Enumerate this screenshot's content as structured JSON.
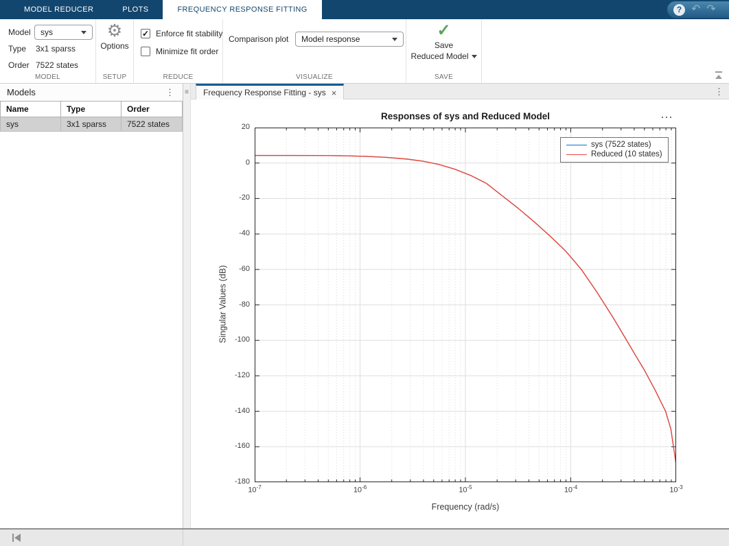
{
  "glyphs": {
    "check": "✓",
    "gear": "⚙",
    "help": "?",
    "undo": "↶",
    "redo": "↷",
    "menu_v": "⋮",
    "grip": "≡",
    "close": "×",
    "ellipsis_h": "⋯"
  },
  "header": {
    "tabs": [
      {
        "label": "MODEL REDUCER"
      },
      {
        "label": "PLOTS"
      },
      {
        "label": "FREQUENCY RESPONSE FITTING"
      }
    ]
  },
  "ribbon": {
    "model_section": {
      "title": "MODEL",
      "model_label": "Model",
      "model_value": "sys",
      "type_label": "Type",
      "type_value": "3x1 sparss",
      "order_label": "Order",
      "order_value": "7522 states"
    },
    "setup_section": {
      "title": "SETUP",
      "options_label": "Options"
    },
    "reduce_section": {
      "title": "REDUCE",
      "checkbox1": {
        "label": "Enforce fit stability",
        "checked": true
      },
      "checkbox2": {
        "label": "Minimize fit order",
        "checked": false
      }
    },
    "visualize_section": {
      "title": "VISUALIZE",
      "comparison_label": "Comparison plot",
      "comparison_value": "Model response"
    },
    "save_section": {
      "title": "SAVE",
      "line1": "Save",
      "line2": "Reduced Model"
    }
  },
  "models_panel": {
    "title": "Models",
    "columns": [
      "Name",
      "Type",
      "Order"
    ],
    "rows": [
      {
        "name": "sys",
        "type": "3x1 sparss",
        "order": "7522 states"
      }
    ]
  },
  "document": {
    "tab_label": "Frequency Response Fitting - sys"
  },
  "chart_data": {
    "type": "line",
    "title": "Responses of sys and Reduced Model",
    "xlabel": "Frequency (rad/s)",
    "ylabel": "Singular Values (dB)",
    "x_scale": "log",
    "xlim_log10": [
      -7,
      -3
    ],
    "ylim": [
      -180,
      20
    ],
    "ytick_step": 20,
    "xtick_labels": [
      "10^-7",
      "10^-6",
      "10^-5",
      "10^-4",
      "10^-3"
    ],
    "grid": true,
    "legend_position": "northeast",
    "colors": {
      "frame": "#262626",
      "grid_major": "#dedede",
      "grid_minor": "#eaeaea",
      "tick": "#262626"
    },
    "series": [
      {
        "name": "sys (7522 states)",
        "color": "#0072BD",
        "width": 1.2,
        "x_log10": [
          -7.0,
          -6.7,
          -6.4,
          -6.15,
          -5.95,
          -5.75,
          -5.55,
          -5.4,
          -5.25,
          -5.1,
          -4.95,
          -4.8,
          -4.65,
          -4.5,
          -4.35,
          -4.2,
          -4.05,
          -3.9,
          -3.75,
          -3.6,
          -3.5,
          -3.4,
          -3.3,
          -3.2,
          -3.1,
          -3.05,
          -3.0
        ],
        "y_db": [
          4.3,
          4.3,
          4.25,
          4.1,
          3.8,
          3.2,
          2.2,
          1.0,
          -0.8,
          -3.5,
          -7.0,
          -11.5,
          -18.5,
          -25.5,
          -33.0,
          -41.0,
          -49.5,
          -60.0,
          -73.0,
          -87.0,
          -97.0,
          -107.0,
          -117.0,
          -128.0,
          -140.0,
          -150.0,
          -170.0
        ]
      },
      {
        "name": "Reduced (10 states)",
        "color": "#e8473c",
        "width": 1.4,
        "x_log10": [
          -7.0,
          -6.7,
          -6.4,
          -6.15,
          -5.95,
          -5.75,
          -5.55,
          -5.4,
          -5.25,
          -5.1,
          -4.95,
          -4.8,
          -4.65,
          -4.5,
          -4.35,
          -4.2,
          -4.05,
          -3.9,
          -3.75,
          -3.6,
          -3.5,
          -3.4,
          -3.3,
          -3.2,
          -3.1,
          -3.05,
          -3.0
        ],
        "y_db": [
          4.3,
          4.3,
          4.25,
          4.1,
          3.8,
          3.2,
          2.2,
          1.0,
          -0.8,
          -3.5,
          -7.0,
          -11.5,
          -18.5,
          -25.5,
          -33.0,
          -41.0,
          -49.5,
          -60.0,
          -73.0,
          -87.0,
          -97.0,
          -107.0,
          -117.0,
          -128.0,
          -140.0,
          -150.0,
          -170.0
        ]
      }
    ]
  }
}
